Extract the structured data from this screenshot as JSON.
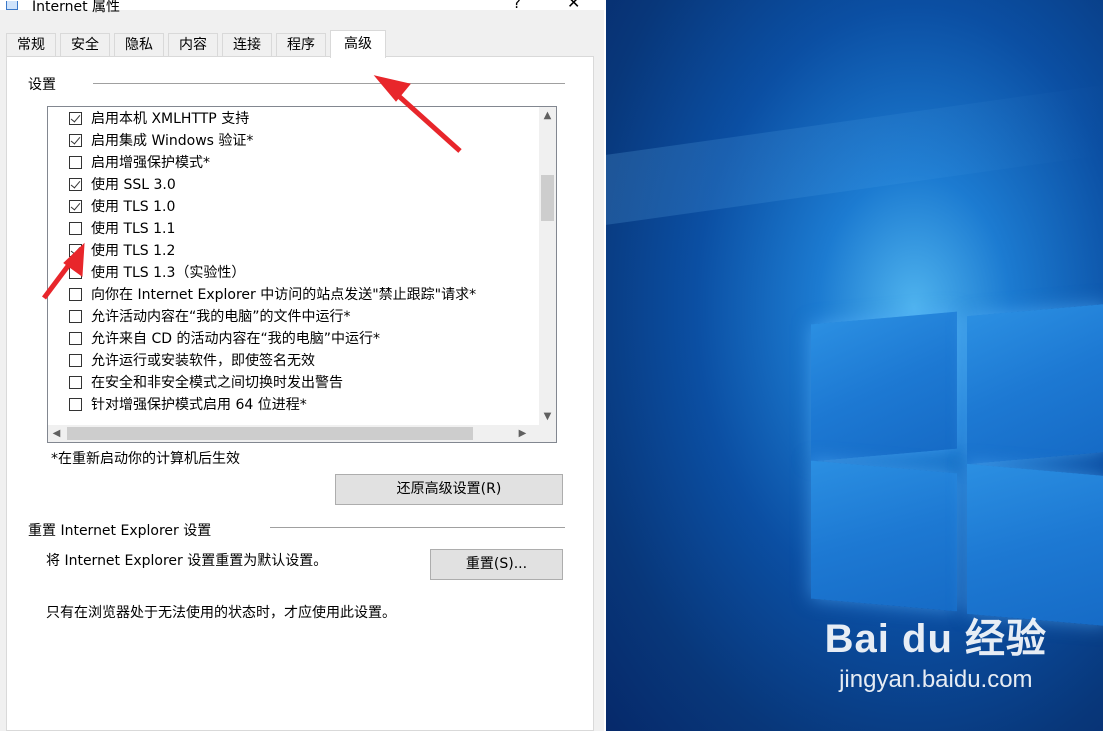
{
  "window": {
    "title": "Internet 属性",
    "help_glyph": "?",
    "close_glyph": "✕"
  },
  "tabs": [
    {
      "label": "常规"
    },
    {
      "label": "安全"
    },
    {
      "label": "隐私"
    },
    {
      "label": "内容"
    },
    {
      "label": "连接"
    },
    {
      "label": "程序"
    },
    {
      "label": "高级",
      "active": true
    }
  ],
  "settings": {
    "group_label": "设置",
    "items": [
      {
        "label": "启用本机 XMLHTTP 支持",
        "checked": true
      },
      {
        "label": "启用集成 Windows 验证*",
        "checked": true
      },
      {
        "label": "启用增强保护模式*",
        "checked": false
      },
      {
        "label": "使用 SSL 3.0",
        "checked": true
      },
      {
        "label": "使用 TLS 1.0",
        "checked": true
      },
      {
        "label": "使用 TLS 1.1",
        "checked": false
      },
      {
        "label": "使用 TLS 1.2",
        "checked": true
      },
      {
        "label": "使用 TLS 1.3（实验性）",
        "checked": false
      },
      {
        "label": "向你在 Internet Explorer 中访问的站点发送\"禁止跟踪\"请求*",
        "checked": false
      },
      {
        "label": "允许活动内容在“我的电脑”的文件中运行*",
        "checked": false
      },
      {
        "label": "允许来自 CD 的活动内容在“我的电脑”中运行*",
        "checked": false
      },
      {
        "label": "允许运行或安装软件，即使签名无效",
        "checked": false
      },
      {
        "label": "在安全和非安全模式之间切换时发出警告",
        "checked": false
      },
      {
        "label": "针对增强保护模式启用 64 位进程*",
        "checked": false
      }
    ],
    "restart_note": "*在重新启动你的计算机后生效",
    "restore_button": "还原高级设置(R)"
  },
  "reset_section": {
    "group_label": "重置 Internet Explorer 设置",
    "description": "将 Internet Explorer 设置重置为默认设置。",
    "reset_button": "重置(S)...",
    "warning": "只有在浏览器处于无法使用的状态时，才应使用此设置。"
  },
  "watermark": {
    "logo_text": "Bai du 经验",
    "url": "jingyan.baidu.com"
  },
  "colors": {
    "annotation_arrow": "#e8262b",
    "desktop_blue": "#0b4fa3"
  }
}
